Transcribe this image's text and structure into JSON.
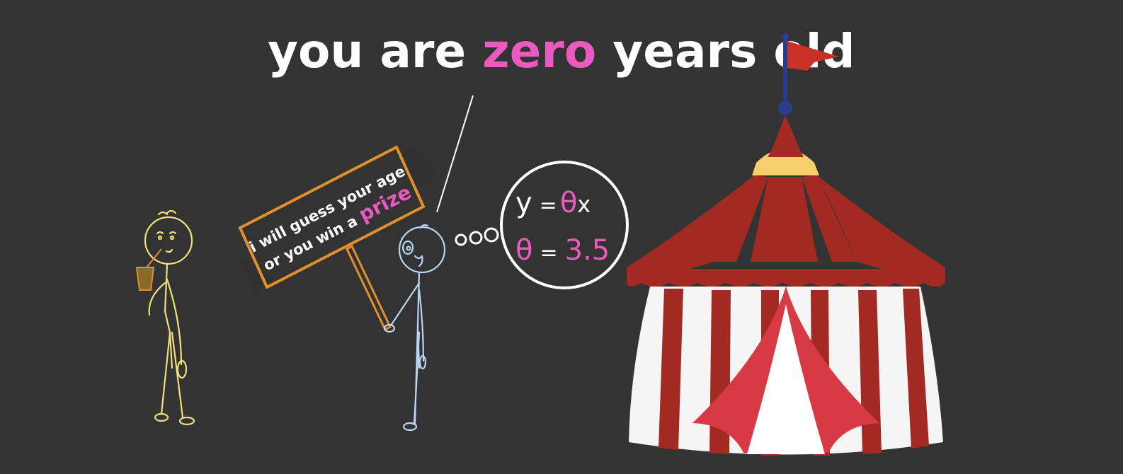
{
  "caption": {
    "before": "you are ",
    "highlight": "zero",
    "after": " years old"
  },
  "sign": {
    "line1": "i will guess your age",
    "line2_before": "or you win a ",
    "line2_highlight": "prize"
  },
  "thought": {
    "eq1_lhs": "y",
    "eq1_eq": "=",
    "eq1_theta": "θ",
    "eq1_rhs": "x",
    "eq2_theta": "θ",
    "eq2_eq": "=",
    "eq2_value": "3.5"
  },
  "colors": {
    "background": "#333333",
    "text": "#ffffff",
    "highlight": "#e95bbf",
    "sign_border": "#e2902c",
    "visitor_stroke": "#f0e07a",
    "guesser_stroke": "#b9d6f5",
    "tent_red": "#a32a22",
    "tent_white": "#f5f5f5",
    "tent_door": "#d83a45",
    "tent_gold": "#f6d06a",
    "flag_red": "#c83226",
    "pole_blue": "#2b3d8f"
  }
}
